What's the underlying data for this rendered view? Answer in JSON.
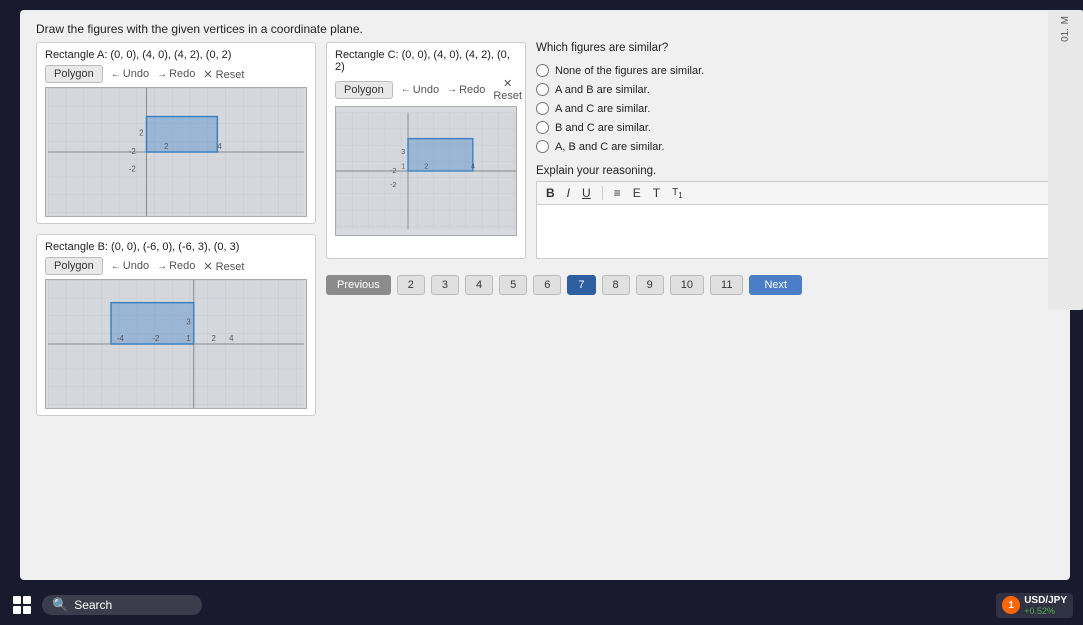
{
  "page": {
    "instructions": "Draw the figures with the given vertices in a coordinate plane.",
    "rectangle_a": {
      "title": "Rectangle A: (0, 0), (4, 0), (4, 2), (0, 2)",
      "polygon_label": "Polygon",
      "undo_label": "Undo",
      "redo_label": "Redo",
      "reset_label": "Reset"
    },
    "rectangle_b": {
      "title": "Rectangle B: (0, 0), (-6, 0), (-6, 3), (0, 3)",
      "polygon_label": "Polygon",
      "undo_label": "Undo",
      "redo_label": "Redo",
      "reset_label": "Reset"
    },
    "rectangle_c": {
      "title": "Rectangle C: (0, 0), (4, 0), (4, 2), (0, 2)",
      "polygon_label": "Polygon",
      "undo_label": "Undo",
      "redo_label": "Redo",
      "reset_label": "Reset"
    },
    "similar_question": "Which figures are similar?",
    "radio_options": [
      "None of the figures are similar.",
      "A and B are similar.",
      "A and C are similar.",
      "B and C are similar.",
      "A, B and C are similar."
    ],
    "explain_label": "Explain your reasoning.",
    "text_toolbar": {
      "bold": "B",
      "italic": "I",
      "underline": "U",
      "list1": "≡",
      "list2": "E",
      "format1": "T",
      "format2": "T₁"
    },
    "navigation": {
      "prev_label": "Previous",
      "page_numbers": [
        "2",
        "3",
        "4",
        "5",
        "6",
        "7",
        "8",
        "9",
        "10",
        "11"
      ],
      "current_page": "7",
      "next_label": "Next"
    },
    "taskbar": {
      "search_placeholder": "Search",
      "ticker_name": "USD/JPY",
      "ticker_change": "+0.52%"
    },
    "side_panel": {
      "label_m": "M",
      "label_01": "01."
    }
  }
}
